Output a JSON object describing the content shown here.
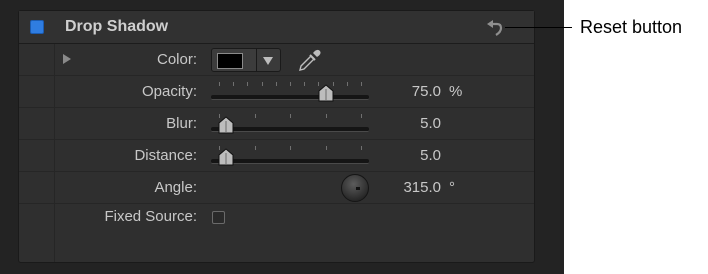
{
  "header": {
    "title": "Drop Shadow",
    "enabled": true,
    "reset_icon": "reset-arrow-icon"
  },
  "params": {
    "color": {
      "label": "Color:",
      "value_color": "#000000",
      "eyedropper_icon": "eyedropper-icon"
    },
    "opacity": {
      "label": "Opacity:",
      "value": "75.0",
      "unit": "%",
      "slider_fraction": 0.75
    },
    "blur": {
      "label": "Blur:",
      "value": "5.0",
      "slider_fraction": 0.05
    },
    "distance": {
      "label": "Distance:",
      "value": "5.0",
      "slider_fraction": 0.05
    },
    "angle": {
      "label": "Angle:",
      "value": "315.0",
      "unit": "°"
    },
    "fixed_source": {
      "label": "Fixed Source:",
      "checked": false
    }
  },
  "callout": {
    "text": "Reset button"
  },
  "colors": {
    "accent": "#2f7de1",
    "panel": "#2f2f2f",
    "text": "#c8c8c8"
  }
}
